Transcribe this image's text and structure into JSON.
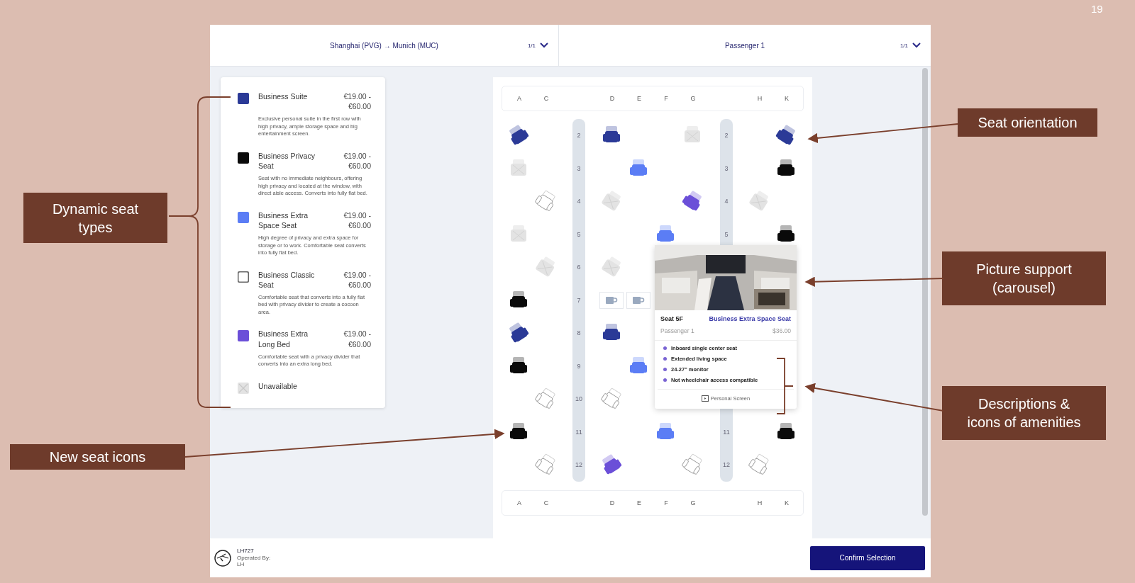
{
  "slide_number": "19",
  "header": {
    "flight": {
      "route": "Shanghai (PVG) → Munich (MUC)",
      "count": "1/1"
    },
    "passenger": {
      "name": "Passenger 1",
      "count": "1/1"
    }
  },
  "legend": [
    {
      "kind": "suite",
      "color": "#2b3a97",
      "name": "Business Suite",
      "price": "€19.00 - €60.00",
      "description": "Exclusive personal suite in the first row with high privacy, ample storage space and big entertainment screen."
    },
    {
      "kind": "privacy",
      "color": "#0a0a0a",
      "name": "Business Privacy Seat",
      "price": "€19.00 - €60.00",
      "description": "Seat with no immediate neighbours, offering high privacy and located at the window, with direct aisle access. Converts into fully flat bed."
    },
    {
      "kind": "extra_space",
      "color": "#5b7df5",
      "name": "Business Extra Space Seat",
      "price": "€19.00 - €60.00",
      "description": "High degree of privacy and extra space for storage or to work. Comfortable seat converts into fully flat bed."
    },
    {
      "kind": "classic",
      "color": "#ffffff",
      "name": "Business Classic Seat",
      "price": "€19.00 - €60.00",
      "description": "Comfortable seat that converts into a fully flat bed with privacy divider to create a cocoon area."
    },
    {
      "kind": "long_bed",
      "color": "#6b4fd8",
      "name": "Business Extra Long Bed",
      "price": "€19.00 - €60.00",
      "description": "Comfortable seat with a privacy divider that converts into an extra long bed."
    },
    {
      "kind": "unavailable",
      "color": "#e3e3e3",
      "name": "Unavailable"
    }
  ],
  "seat_map": {
    "columns": [
      "A",
      "C",
      "D",
      "E",
      "F",
      "G",
      "H",
      "K"
    ],
    "rows": [
      {
        "left_label": "2",
        "right_label": "2",
        "seats": [
          {
            "kind": "suite",
            "tilt_left": true,
            "tilt_right": false
          },
          {
            "kind": "empty"
          },
          {
            "kind": "suite",
            "tilt_left": false,
            "tilt_right": false
          },
          {
            "kind": "empty"
          },
          {
            "kind": "empty"
          },
          {
            "kind": "unavailable",
            "tilt_left": false,
            "tilt_right": false
          },
          {
            "kind": "empty"
          },
          {
            "kind": "suite",
            "tilt_left": false,
            "tilt_right": true
          }
        ]
      },
      {
        "left_label": "3",
        "right_label": "3",
        "seats": [
          {
            "kind": "unavailable",
            "tilt_left": false,
            "tilt_right": false
          },
          {
            "kind": "empty"
          },
          {
            "kind": "empty"
          },
          {
            "kind": "extra_space",
            "tilt_left": false,
            "tilt_right": false
          },
          {
            "kind": "empty"
          },
          {
            "kind": "empty"
          },
          {
            "kind": "empty"
          },
          {
            "kind": "privacy",
            "tilt_left": false,
            "tilt_right": false
          }
        ]
      },
      {
        "left_label": "4",
        "right_label": "4",
        "seats": [
          {
            "kind": "empty"
          },
          {
            "kind": "classic",
            "tilt_left": false,
            "tilt_right": true
          },
          {
            "kind": "unavailable",
            "tilt_left": false,
            "tilt_right": true
          },
          {
            "kind": "empty"
          },
          {
            "kind": "empty"
          },
          {
            "kind": "long_bed",
            "tilt_left": false,
            "tilt_right": true
          },
          {
            "kind": "unavailable",
            "tilt_left": false,
            "tilt_right": true
          },
          {
            "kind": "empty"
          }
        ]
      },
      {
        "left_label": "5",
        "right_label": "5",
        "seats": [
          {
            "kind": "unavailable",
            "tilt_left": false,
            "tilt_right": false
          },
          {
            "kind": "empty"
          },
          {
            "kind": "empty"
          },
          {
            "kind": "empty"
          },
          {
            "kind": "extra_space",
            "tilt_left": false,
            "tilt_right": false
          },
          {
            "kind": "empty"
          },
          {
            "kind": "empty"
          },
          {
            "kind": "privacy",
            "tilt_left": false,
            "tilt_right": false
          }
        ]
      },
      {
        "left_label": "6",
        "seats": [
          {
            "kind": "empty"
          },
          {
            "kind": "unavailable",
            "tilt_left": false,
            "tilt_right": true
          },
          {
            "kind": "unavailable",
            "tilt_left": false,
            "tilt_right": true
          },
          {
            "kind": "empty"
          },
          {
            "kind": "empty"
          },
          {
            "kind": "empty"
          },
          {
            "kind": "empty"
          },
          {
            "kind": "empty"
          }
        ]
      },
      {
        "left_label": "7",
        "seats": [
          {
            "kind": "privacy",
            "tilt_left": false,
            "tilt_right": false
          },
          {
            "kind": "empty"
          },
          {
            "kind": "galley"
          },
          {
            "kind": "galley"
          },
          {
            "kind": "empty"
          },
          {
            "kind": "empty"
          },
          {
            "kind": "empty"
          },
          {
            "kind": "empty"
          }
        ]
      },
      {
        "left_label": "8",
        "seats": [
          {
            "kind": "suite",
            "tilt_left": true,
            "tilt_right": false
          },
          {
            "kind": "empty"
          },
          {
            "kind": "suite",
            "tilt_left": false,
            "tilt_right": false
          },
          {
            "kind": "empty"
          },
          {
            "kind": "empty"
          },
          {
            "kind": "empty"
          },
          {
            "kind": "empty"
          },
          {
            "kind": "empty"
          }
        ]
      },
      {
        "left_label": "9",
        "seats": [
          {
            "kind": "privacy",
            "tilt_left": false,
            "tilt_right": false
          },
          {
            "kind": "empty"
          },
          {
            "kind": "empty"
          },
          {
            "kind": "extra_space",
            "tilt_left": false,
            "tilt_right": false
          },
          {
            "kind": "empty"
          },
          {
            "kind": "empty"
          },
          {
            "kind": "empty"
          },
          {
            "kind": "empty"
          }
        ]
      },
      {
        "left_label": "10",
        "seats": [
          {
            "kind": "empty"
          },
          {
            "kind": "classic",
            "tilt_left": false,
            "tilt_right": true
          },
          {
            "kind": "classic",
            "tilt_left": false,
            "tilt_right": true
          },
          {
            "kind": "empty"
          },
          {
            "kind": "empty"
          },
          {
            "kind": "empty"
          },
          {
            "kind": "empty"
          },
          {
            "kind": "empty"
          }
        ]
      },
      {
        "left_label": "11",
        "right_label": "11",
        "seats": [
          {
            "kind": "privacy",
            "tilt_left": false,
            "tilt_right": false
          },
          {
            "kind": "empty"
          },
          {
            "kind": "empty"
          },
          {
            "kind": "empty"
          },
          {
            "kind": "extra_space",
            "tilt_left": false,
            "tilt_right": false
          },
          {
            "kind": "empty"
          },
          {
            "kind": "empty"
          },
          {
            "kind": "privacy",
            "tilt_left": false,
            "tilt_right": false
          }
        ]
      },
      {
        "left_label": "12",
        "right_label": "12",
        "seats": [
          {
            "kind": "empty"
          },
          {
            "kind": "classic",
            "tilt_left": false,
            "tilt_right": true
          },
          {
            "kind": "long_bed",
            "tilt_left": true,
            "tilt_right": false
          },
          {
            "kind": "empty"
          },
          {
            "kind": "empty"
          },
          {
            "kind": "classic",
            "tilt_left": false,
            "tilt_right": true
          },
          {
            "kind": "classic",
            "tilt_left": false,
            "tilt_right": true
          },
          {
            "kind": "empty"
          }
        ]
      }
    ],
    "footer_columns": [
      "A",
      "C",
      "D",
      "E",
      "F",
      "G",
      "H",
      "K"
    ]
  },
  "seat_popup": {
    "picture": {
      "kind": "picture"
    },
    "seat": "Seat 5F",
    "seat_type": "Business Extra Space Seat",
    "passenger": "Passenger 1",
    "price": "$36.00",
    "amenities": [
      "Inboard single center seat",
      "Extended living space",
      "24-27\" monitor",
      "Not wheelchair access compatible"
    ],
    "feature": "Personal Screen"
  },
  "footer": {
    "flight_number": "LH727",
    "operated_label": "Operated By:",
    "operator": "LH",
    "confirm_button": "Confirm Selection"
  },
  "annotations": [
    {
      "kind": "types",
      "text": "Dynamic seat types"
    },
    {
      "kind": "icons",
      "text": "New seat icons"
    },
    {
      "kind": "orientation",
      "text": "Seat orientation"
    },
    {
      "kind": "picture",
      "text": "Picture support (carousel)"
    },
    {
      "kind": "amenities",
      "text": "Descriptions & icons of amenities"
    }
  ]
}
